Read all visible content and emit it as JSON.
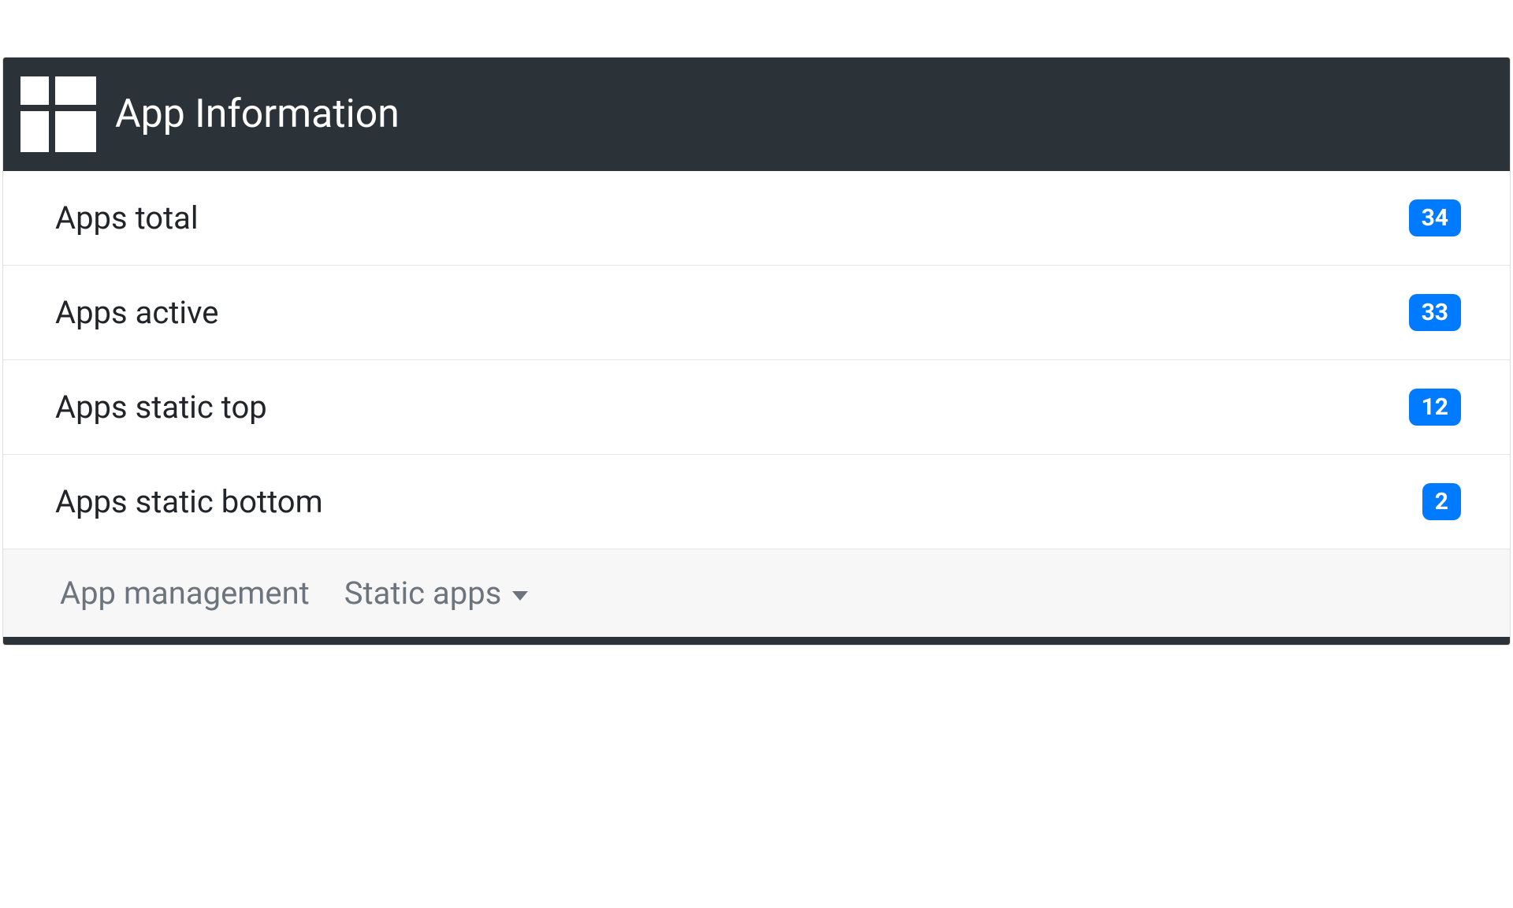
{
  "header": {
    "title": "App Information"
  },
  "items": [
    {
      "label": "Apps total",
      "value": "34"
    },
    {
      "label": "Apps active",
      "value": "33"
    },
    {
      "label": "Apps static top",
      "value": "12"
    },
    {
      "label": "Apps static bottom",
      "value": "2"
    }
  ],
  "footer": {
    "app_management": "App management",
    "static_apps": "Static apps"
  }
}
